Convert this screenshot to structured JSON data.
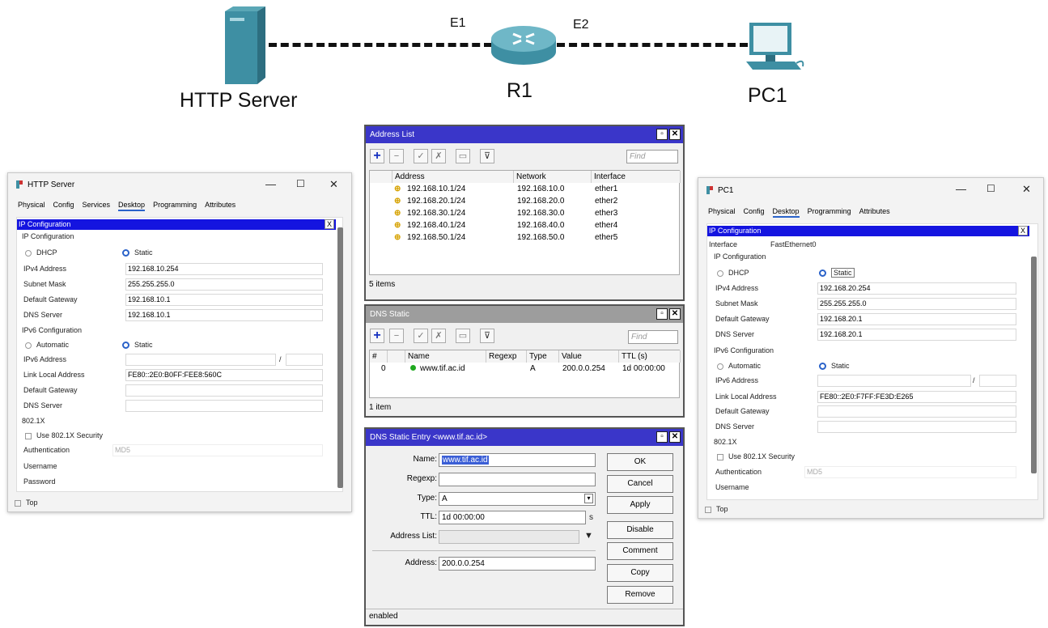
{
  "topology": {
    "server_label": "HTTP Server",
    "router_label": "R1",
    "pc_label": "PC1",
    "link_left": "E1",
    "link_right": "E2"
  },
  "server_window": {
    "title": "HTTP Server",
    "tabs": [
      "Physical",
      "Config",
      "Services",
      "Desktop",
      "Programming",
      "Attributes"
    ],
    "panel_title": "IP Configuration",
    "ip_section": "IP Configuration",
    "dhcp": "DHCP",
    "static": "Static",
    "ipv4_label": "IPv4 Address",
    "ipv4": "192.168.10.254",
    "mask_label": "Subnet Mask",
    "mask": "255.255.255.0",
    "gw_label": "Default Gateway",
    "gw": "192.168.10.1",
    "dns_label": "DNS Server",
    "dns": "192.168.10.1",
    "ipv6_section": "IPv6 Configuration",
    "automatic": "Automatic",
    "static6": "Static",
    "ipv6_label": "IPv6 Address",
    "slash": "/",
    "lla_label": "Link Local Address",
    "lla": "FE80::2E0:B0FF:FEE8:560C",
    "gw6_label": "Default Gateway",
    "dns6_label": "DNS Server",
    "dot1x_section": "802.1X",
    "dot1x_use": "Use 802.1X Security",
    "auth_label": "Authentication",
    "auth_value": "MD5",
    "user_label": "Username",
    "pass_label": "Password",
    "top_label": "Top"
  },
  "pc_window": {
    "title": "PC1",
    "tabs": [
      "Physical",
      "Config",
      "Desktop",
      "Programming",
      "Attributes"
    ],
    "panel_title": "IP Configuration",
    "interface_label": "Interface",
    "interface_value": "FastEthernet0",
    "ip_section": "IP Configuration",
    "dhcp": "DHCP",
    "static": "Static",
    "ipv4_label": "IPv4 Address",
    "ipv4": "192.168.20.254",
    "mask_label": "Subnet Mask",
    "mask": "255.255.255.0",
    "gw_label": "Default Gateway",
    "gw": "192.168.20.1",
    "dns_label": "DNS Server",
    "dns": "192.168.20.1",
    "ipv6_section": "IPv6 Configuration",
    "automatic": "Automatic",
    "static6": "Static",
    "ipv6_label": "IPv6 Address",
    "slash": "/",
    "lla_label": "Link Local Address",
    "lla": "FE80::2E0:F7FF:FE3D:E265",
    "gw6_label": "Default Gateway",
    "dns6_label": "DNS Server",
    "dot1x_section": "802.1X",
    "dot1x_use": "Use 802.1X Security",
    "auth_label": "Authentication",
    "auth_value": "MD5",
    "user_label": "Username",
    "top_label": "Top"
  },
  "address_list": {
    "title": "Address List",
    "find_placeholder": "Find",
    "headers": [
      "Address",
      "Network",
      "Interface"
    ],
    "rows": [
      {
        "address": "192.168.10.1/24",
        "network": "192.168.10.0",
        "interface": "ether1"
      },
      {
        "address": "192.168.20.1/24",
        "network": "192.168.20.0",
        "interface": "ether2"
      },
      {
        "address": "192.168.30.1/24",
        "network": "192.168.30.0",
        "interface": "ether3"
      },
      {
        "address": "192.168.40.1/24",
        "network": "192.168.40.0",
        "interface": "ether4"
      },
      {
        "address": "192.168.50.1/24",
        "network": "192.168.50.0",
        "interface": "ether5"
      }
    ],
    "status": "5 items"
  },
  "dns_static": {
    "title": "DNS Static",
    "find_placeholder": "Find",
    "headers": [
      "#",
      "Name",
      "Regexp",
      "Type",
      "Value",
      "TTL (s)"
    ],
    "row": {
      "num": "0",
      "name": "www.tif.ac.id",
      "regexp": "",
      "type": "A",
      "value": "200.0.0.254",
      "ttl": "1d 00:00:00"
    },
    "status": "1 item"
  },
  "dns_entry": {
    "title": "DNS Static Entry <www.tif.ac.id>",
    "name_label": "Name:",
    "name": "www.tif.ac.id",
    "regexp_label": "Regexp:",
    "type_label": "Type:",
    "type": "A",
    "ttl_label": "TTL:",
    "ttl": "1d 00:00:00",
    "ttl_unit": "s",
    "addrlist_label": "Address List:",
    "address_label": "Address:",
    "address": "200.0.0.254",
    "buttons": [
      "OK",
      "Cancel",
      "Apply",
      "Disable",
      "Comment",
      "Copy",
      "Remove"
    ],
    "status": "enabled"
  },
  "colors": {
    "winbox_title_active": "#3a36c9",
    "pt_bar": "#1414e0",
    "accent": "#2a62c9"
  }
}
